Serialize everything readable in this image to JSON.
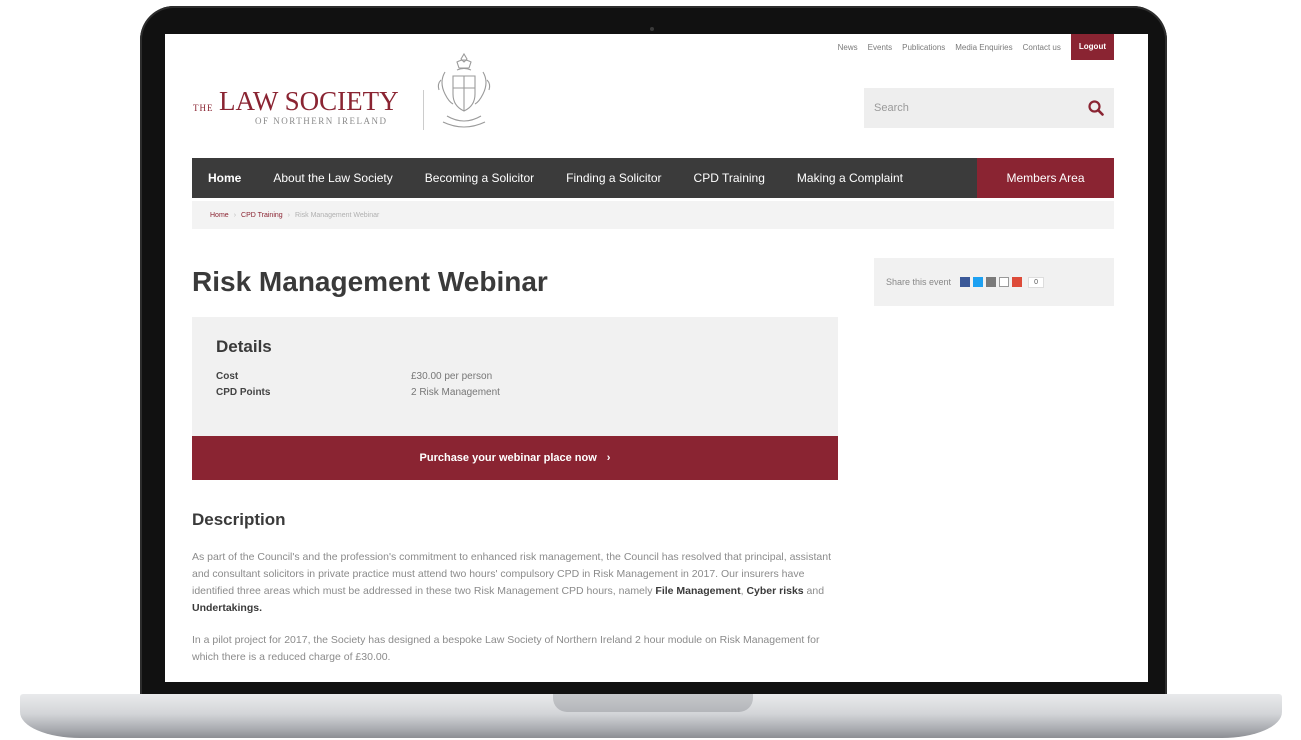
{
  "topnav": {
    "links": [
      "News",
      "Events",
      "Publications",
      "Media Enquiries",
      "Contact us"
    ],
    "logout_label": "Logout"
  },
  "logo": {
    "the": "THE",
    "main": "LAW SOCIETY",
    "sub": "OF NORTHERN IRELAND"
  },
  "search": {
    "placeholder": "Search",
    "icon": "search-icon"
  },
  "mainnav": {
    "items": [
      "Home",
      "About the Law Society",
      "Becoming a Solicitor",
      "Finding a Solicitor",
      "CPD Training",
      "Making a Complaint"
    ],
    "members_label": "Members Area"
  },
  "breadcrumb": {
    "home": "Home",
    "cpd": "CPD Training",
    "current": "Risk Management Webinar"
  },
  "page": {
    "title": "Risk Management Webinar"
  },
  "share": {
    "label": "Share this event",
    "count": "0"
  },
  "details": {
    "heading": "Details",
    "rows": [
      {
        "key": "Cost",
        "value": "£30.00 per person"
      },
      {
        "key": "CPD Points",
        "value": "2 Risk Management"
      }
    ]
  },
  "purchase": {
    "label": "Purchase your webinar place now",
    "chevron": "›"
  },
  "description": {
    "heading": "Description",
    "p1_text": "As part of the Council's and the profession's commitment to enhanced risk management, the Council has resolved that principal, assistant and consultant solicitors in private practice must attend two hours' compulsory CPD in Risk Management in 2017. Our insurers have identified three areas which must be addressed in these two Risk Management CPD hours, namely ",
    "p1_b1": "File Management",
    "p1_sep1": ", ",
    "p1_b2": "Cyber risks",
    "p1_sep2": " and ",
    "p1_b3": "Undertakings.",
    "p2_text": "In a pilot project for 2017, the Society has designed a bespoke Law Society of Northern Ireland 2 hour module on Risk Management for which there is a reduced charge of £30.00."
  },
  "colors": {
    "brand": "#8a2432",
    "nav": "#3b3b3b",
    "panel": "#f1f1f1",
    "share_icons": [
      "#3b5998",
      "#1da1f2",
      "#7a7a7a",
      "#9a9a9a",
      "#dd4b39"
    ]
  }
}
